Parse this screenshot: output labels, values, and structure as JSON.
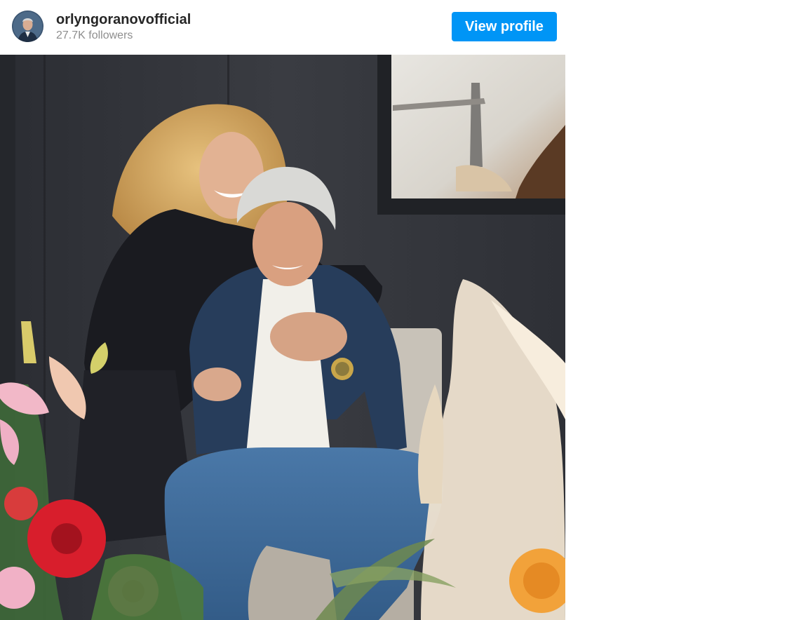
{
  "header": {
    "username": "orlyngoranovofficial",
    "followers": "27.7K followers",
    "view_profile_label": "View profile",
    "avatar_icon": "profile-photo"
  },
  "post": {
    "image_icon": "photo-couple-on-sofa-with-flowers"
  },
  "colors": {
    "button": "#0095f6",
    "username": "#262626",
    "secondary_text": "#8e8e8e",
    "background": "#ffffff"
  }
}
